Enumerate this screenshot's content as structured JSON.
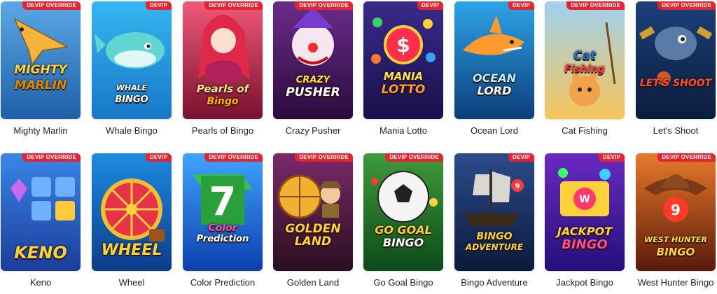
{
  "badge_colors": {
    "background": "#e8232f",
    "text": "#ffffff"
  },
  "games": [
    {
      "name": "Mighty Marlin",
      "badge": "DEVIP OVERRIDE",
      "art_text": [
        "MIGHTY",
        "MARLIN"
      ],
      "icon": "marlin-fish-icon"
    },
    {
      "name": "Whale Bingo",
      "badge": "DEVIP",
      "art_text": [
        "WHALE",
        "BINGO"
      ],
      "icon": "whale-icon"
    },
    {
      "name": "Pearls of Bingo",
      "badge": "DEVIP OVERRIDE",
      "art_text": [
        "Pearls of",
        "Bingo"
      ],
      "icon": "mermaid-icon"
    },
    {
      "name": "Crazy Pusher",
      "badge": "DEVIP OVERRIDE",
      "art_text": [
        "CRAZY",
        "PUSHER"
      ],
      "icon": "clown-icon"
    },
    {
      "name": "Mania Lotto",
      "badge": "DEVIP",
      "art_text": [
        "MANIA",
        "LOTTO"
      ],
      "icon": "dollar-ball-icon"
    },
    {
      "name": "Ocean Lord",
      "badge": "DEVIP",
      "art_text": [
        "OCEAN",
        "LORD"
      ],
      "icon": "shark-icon"
    },
    {
      "name": "Cat Fishing",
      "badge": "DEVIP OVERRIDE",
      "art_text": [
        "Cat",
        "Fishing"
      ],
      "icon": "cat-icon"
    },
    {
      "name": "Let's Shoot",
      "badge": "DEVIP OVERRIDE",
      "art_text": [
        "LET'S SHOOT"
      ],
      "icon": "shark-cannon-icon"
    },
    {
      "name": "Keno",
      "badge": "DEVIP OVERRIDE",
      "art_text": [
        "KENO"
      ],
      "icon": "gem-icon"
    },
    {
      "name": "Wheel",
      "badge": "DEVIP",
      "art_text": [
        "WHEEL"
      ],
      "icon": "prize-wheel-icon"
    },
    {
      "name": "Color Prediction",
      "badge": "DEVIP OVERRIDE",
      "art_text": [
        "Color",
        "Prediction"
      ],
      "icon": "number-seven-icon"
    },
    {
      "name": "Golden Land",
      "badge": "DEVIP OVERRIDE",
      "art_text": [
        "GOLDEN",
        "LAND"
      ],
      "icon": "explorer-icon"
    },
    {
      "name": "Go Goal Bingo",
      "badge": "DEVIP OVERRIDE",
      "art_text": [
        "GO GOAL",
        "BINGO"
      ],
      "icon": "soccer-ball-icon"
    },
    {
      "name": "Bingo Adventure",
      "badge": "DEVIP",
      "art_text": [
        "BINGO",
        "ADVENTURE"
      ],
      "icon": "pirate-ship-icon"
    },
    {
      "name": "Jackpot Bingo",
      "badge": "DEVIP",
      "art_text": [
        "JACKPOT",
        "BINGO"
      ],
      "icon": "bingo-balls-icon"
    },
    {
      "name": "West Hunter Bingo",
      "badge": "DEVIP OVERRIDE",
      "art_text": [
        "WEST HUNTER",
        "BINGO"
      ],
      "icon": "cowboy-hat-icon"
    }
  ]
}
